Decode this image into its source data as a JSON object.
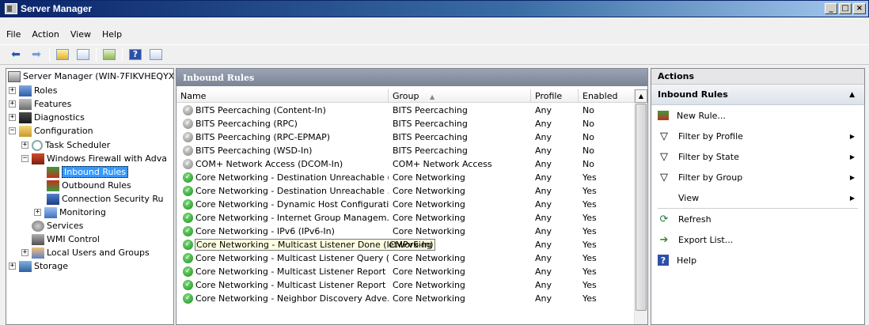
{
  "window": {
    "title": "Server Manager",
    "buttons": [
      "_",
      "□",
      "×"
    ]
  },
  "menu": [
    "File",
    "Action",
    "View",
    "Help"
  ],
  "tree": {
    "items": [
      {
        "label": "Server Manager (WIN-7FIKVHEQYX",
        "icon": "server-icon",
        "expander": ""
      },
      {
        "label": "Roles",
        "icon": "roles-icon",
        "expander": "+"
      },
      {
        "label": "Features",
        "icon": "features-icon",
        "expander": "+"
      },
      {
        "label": "Diagnostics",
        "icon": "diagnostics-icon",
        "expander": "+"
      },
      {
        "label": "Configuration",
        "icon": "configuration-icon",
        "expander": "−"
      },
      {
        "label": "Task Scheduler",
        "icon": "clock-icon",
        "expander": "+"
      },
      {
        "label": "Windows Firewall with Adva",
        "icon": "firewall-icon",
        "expander": "−"
      },
      {
        "label": "Inbound Rules",
        "icon": "inbound-rules-icon",
        "expander": ""
      },
      {
        "label": "Outbound Rules",
        "icon": "outbound-rules-icon",
        "expander": ""
      },
      {
        "label": "Connection Security Ru",
        "icon": "connection-security-icon",
        "expander": ""
      },
      {
        "label": "Monitoring",
        "icon": "monitoring-icon",
        "expander": "+"
      },
      {
        "label": "Services",
        "icon": "services-icon",
        "expander": ""
      },
      {
        "label": "WMI Control",
        "icon": "wmi-icon",
        "expander": ""
      },
      {
        "label": "Local Users and Groups",
        "icon": "users-icon",
        "expander": "+"
      },
      {
        "label": "Storage",
        "icon": "storage-icon",
        "expander": "+"
      }
    ]
  },
  "center": {
    "title": "Inbound Rules",
    "columns": {
      "name": "Name",
      "group": "Group",
      "group_sort": "▲",
      "profile": "Profile",
      "enabled": "Enabled"
    },
    "rows": [
      {
        "name": "BITS Peercaching (Content-In)",
        "group": "BITS Peercaching",
        "profile": "Any",
        "enabled": "No"
      },
      {
        "name": "BITS Peercaching (RPC)",
        "group": "BITS Peercaching",
        "profile": "Any",
        "enabled": "No"
      },
      {
        "name": "BITS Peercaching (RPC-EPMAP)",
        "group": "BITS Peercaching",
        "profile": "Any",
        "enabled": "No"
      },
      {
        "name": "BITS Peercaching (WSD-In)",
        "group": "BITS Peercaching",
        "profile": "Any",
        "enabled": "No"
      },
      {
        "name": "COM+ Network Access (DCOM-In)",
        "group": "COM+ Network Access",
        "profile": "Any",
        "enabled": "No"
      },
      {
        "name": "Core Networking - Destination Unreachable (...",
        "group": "Core Networking",
        "profile": "Any",
        "enabled": "Yes"
      },
      {
        "name": "Core Networking - Destination Unreachable ...",
        "group": "Core Networking",
        "profile": "Any",
        "enabled": "Yes"
      },
      {
        "name": "Core Networking - Dynamic Host Configurati...",
        "group": "Core Networking",
        "profile": "Any",
        "enabled": "Yes"
      },
      {
        "name": "Core Networking - Internet Group Managem...",
        "group": "Core Networking",
        "profile": "Any",
        "enabled": "Yes"
      },
      {
        "name": "Core Networking - IPv6 (IPv6-In)",
        "group": "Core Networking",
        "profile": "Any",
        "enabled": "Yes"
      },
      {
        "name": "Core Networking - Multicast Listener Done (ICMPv6-In)",
        "group": "etworking",
        "profile": "Any",
        "enabled": "Yes"
      },
      {
        "name": "Core Networking - Multicast Listener Query (...",
        "group": "Core Networking",
        "profile": "Any",
        "enabled": "Yes"
      },
      {
        "name": "Core Networking - Multicast Listener Report ...",
        "group": "Core Networking",
        "profile": "Any",
        "enabled": "Yes"
      },
      {
        "name": "Core Networking - Multicast Listener Report ...",
        "group": "Core Networking",
        "profile": "Any",
        "enabled": "Yes"
      },
      {
        "name": "Core Networking - Neighbor Discovery Adve...",
        "group": "Core Networking",
        "profile": "Any",
        "enabled": "Yes"
      }
    ]
  },
  "actions": {
    "title": "Actions",
    "section": "Inbound Rules",
    "items": [
      {
        "label": "New Rule...",
        "icon": "new-rule-icon",
        "submenu": false
      },
      {
        "label": "Filter by Profile",
        "icon": "filter-icon",
        "submenu": true
      },
      {
        "label": "Filter by State",
        "icon": "filter-icon",
        "submenu": true
      },
      {
        "label": "Filter by Group",
        "icon": "filter-icon",
        "submenu": true
      },
      {
        "label": "View",
        "icon": "",
        "submenu": true
      },
      {
        "label": "Refresh",
        "icon": "refresh-icon",
        "submenu": false
      },
      {
        "label": "Export List...",
        "icon": "export-icon",
        "submenu": false
      },
      {
        "label": "Help",
        "icon": "help-icon",
        "submenu": false
      }
    ]
  }
}
